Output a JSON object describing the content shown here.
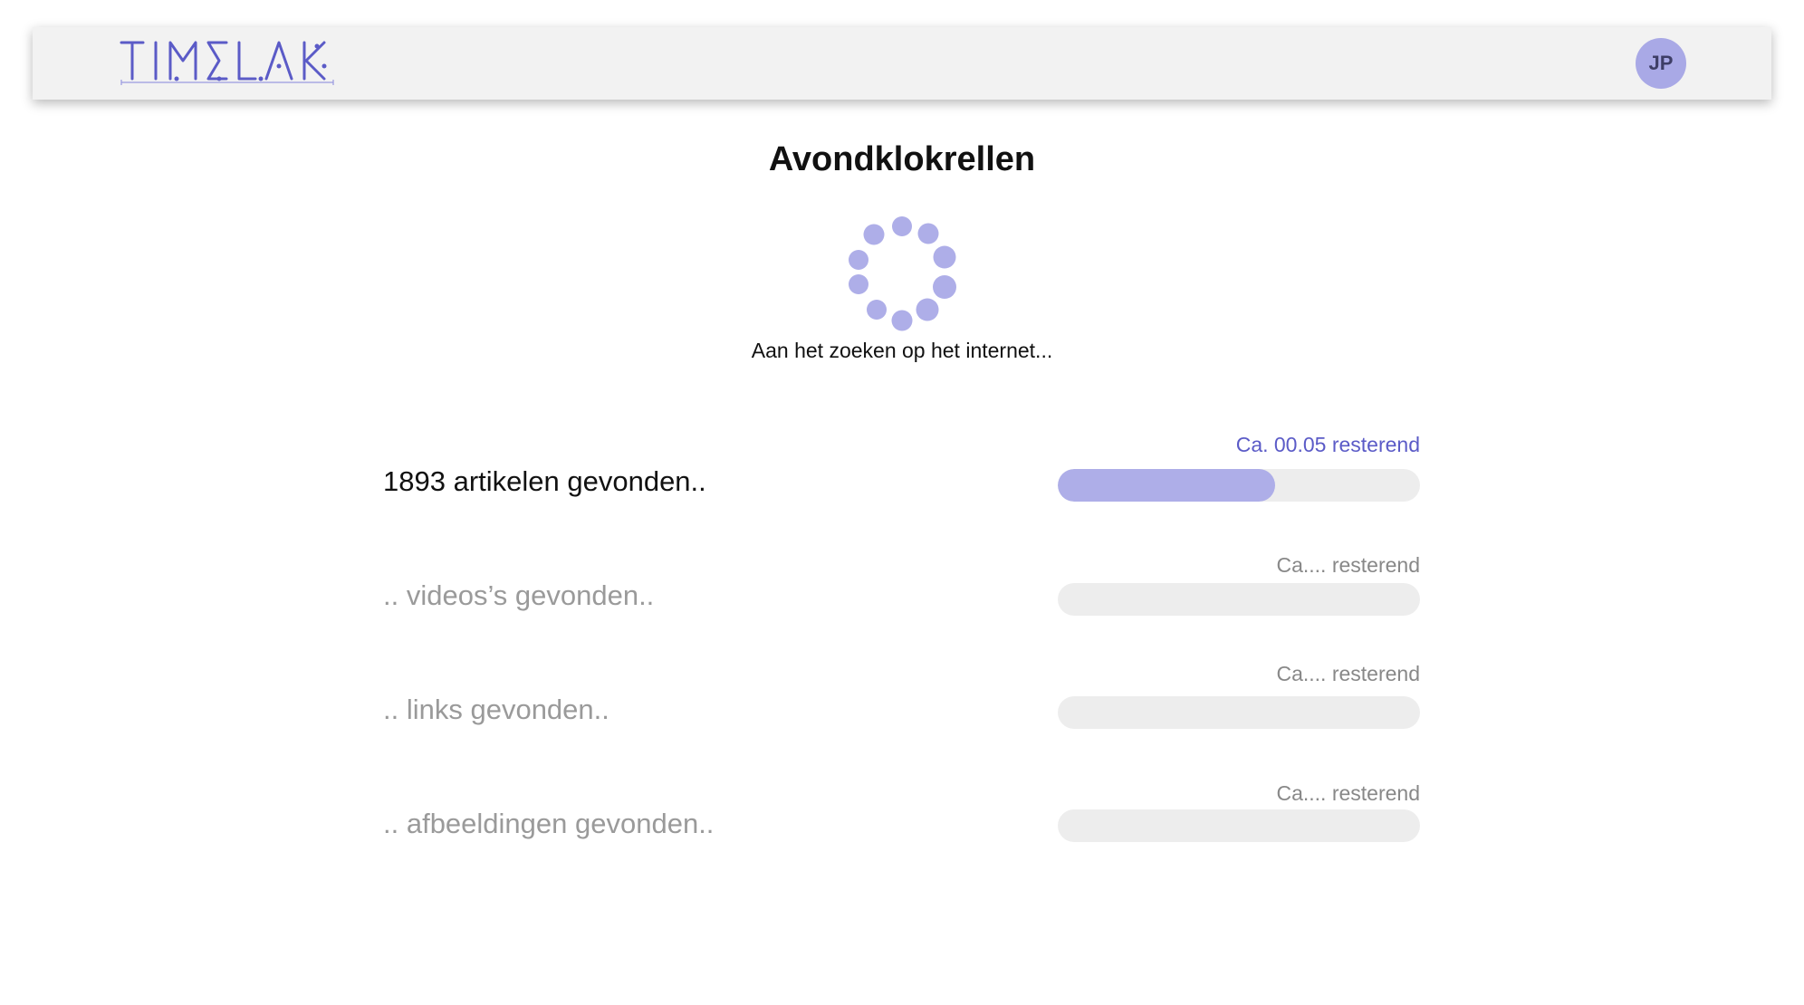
{
  "header": {
    "logo_text": "TIMELAB",
    "avatar_initials": "JP"
  },
  "main": {
    "title": "Avondklokrellen",
    "status_text": "Aan het zoeken op het internet..."
  },
  "results": [
    {
      "label": "1893 artikelen gevonden..",
      "remaining": "Ca. 00.05 resterend",
      "progress": 0.6,
      "state": "active"
    },
    {
      "label": ".. videos’s gevonden..",
      "remaining": "Ca.... resterend",
      "progress": 0,
      "state": "pending"
    },
    {
      "label": ".. links gevonden..",
      "remaining": "Ca.... resterend",
      "progress": 0,
      "state": "pending"
    },
    {
      "label": ".. afbeeldingen gevonden..",
      "remaining": "Ca.... resterend",
      "progress": 0,
      "state": "pending"
    }
  ],
  "colors": {
    "accent": "#5b5bc7",
    "progress_fill": "#aeaee8",
    "track": "#ededed",
    "avatar_bg": "#a9a9e6"
  },
  "icons": {
    "spinner": "loading-spinner-icon"
  }
}
